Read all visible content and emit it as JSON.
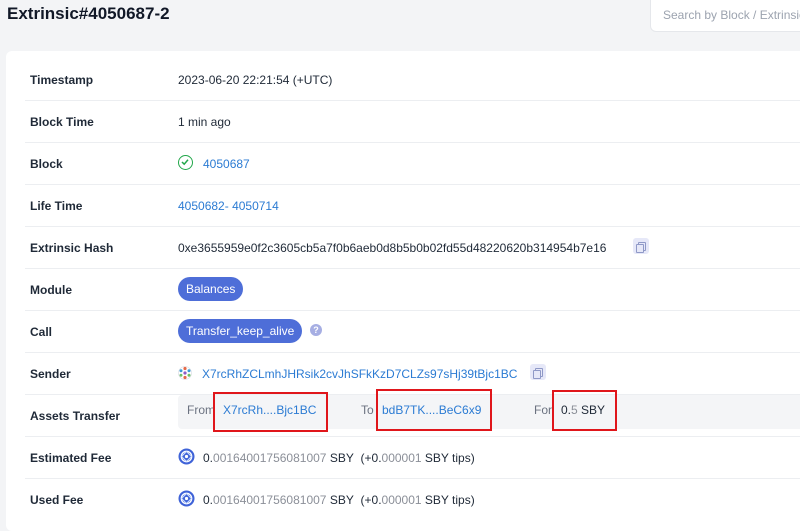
{
  "header": {
    "title": "Extrinsic#4050687-2",
    "search_placeholder": "Search by Block / Extrinsic"
  },
  "details": {
    "timestamp": {
      "label": "Timestamp",
      "value": "2023-06-20 22:21:54 (+UTC)"
    },
    "block_time": {
      "label": "Block Time",
      "value": "1 min ago"
    },
    "block": {
      "label": "Block",
      "value": "4050687"
    },
    "life_time": {
      "label": "Life Time",
      "start": "4050682",
      "separator": "-",
      "end": "4050714"
    },
    "extrinsic_hash": {
      "label": "Extrinsic Hash",
      "value": "0xe3655959e0f2c3605cb5a7f0b6aeb0d8b5b0b02fd55d48220620b314954b7e16"
    },
    "module": {
      "label": "Module",
      "value": "Balances"
    },
    "call": {
      "label": "Call",
      "value": "Transfer_keep_alive",
      "help": "?"
    },
    "sender": {
      "label": "Sender",
      "value": "X7rcRhZCLmhJHRsik2cvJhSFkKzD7CLZs97sHj39tBjc1BC"
    },
    "assets_transfer": {
      "label": "Assets Transfer",
      "from_label": "From",
      "from_value": "X7rcRh....Bjc1BC",
      "to_label": "To",
      "to_value": "bdB7TK....BeC6x9",
      "for_label": "For",
      "amount_int": "0.",
      "amount_dec": "5",
      "unit": "SBY"
    },
    "estimated_fee": {
      "label": "Estimated Fee",
      "int": "0.",
      "dec": "00164001756081007",
      "unit": "SBY",
      "tip_prefix": "(+0.",
      "tip_dec": "000001",
      "tip_suffix": "SBY tips)"
    },
    "used_fee": {
      "label": "Used Fee",
      "int": "0.",
      "dec": "00164001756081007",
      "unit": "SBY",
      "tip_prefix": "(+0.",
      "tip_dec": "000001",
      "tip_suffix": "SBY tips)"
    }
  },
  "icons": {
    "block_status": "check-circle-icon",
    "copy": "copy-icon",
    "help": "question-icon",
    "sender_avatar": "identicon-icon",
    "token": "shiden-token-icon"
  },
  "colors": {
    "link": "#2b7bd3",
    "pill": "#4e6ed8",
    "highlight": "#e0161b",
    "success": "#22a74a"
  }
}
